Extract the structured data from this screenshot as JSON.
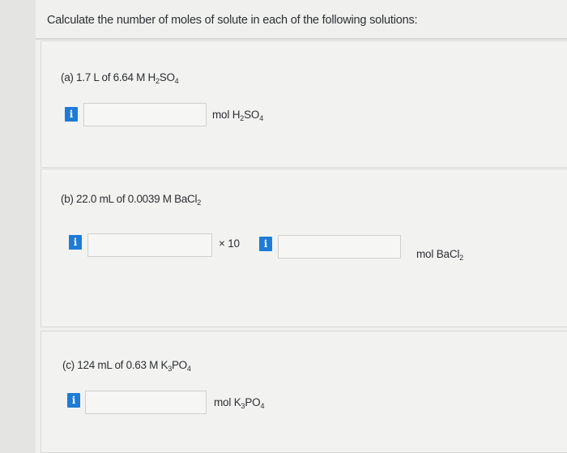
{
  "question": "Calculate the number of moles of solute in each of the following solutions:",
  "parts": {
    "a": {
      "label": {
        "lead": "(a) 1.7 L of 6.64 M H",
        "s1": "2",
        "mid": "SO",
        "s2": "4",
        "tail": ""
      },
      "info": "i",
      "input_value": "",
      "unit": {
        "lead": "mol H",
        "s1": "2",
        "mid": "SO",
        "s2": "4"
      }
    },
    "b": {
      "label": {
        "lead": "(b) 22.0 mL of 0.0039 M BaCl",
        "s1": "2"
      },
      "info_coefficient": "i",
      "coefficient_value": "",
      "times_ten": "× 10",
      "info_exponent": "i",
      "exponent_value": "",
      "unit": {
        "lead": "mol BaCl",
        "s1": "2"
      }
    },
    "c": {
      "label": {
        "lead": "(c) 124  mL of 0.63 M K",
        "s1": "3",
        "mid": "PO",
        "s2": "4"
      },
      "info": "i",
      "input_value": "",
      "unit": {
        "lead": "mol K",
        "s1": "3",
        "mid": "PO",
        "s2": "4"
      }
    }
  },
  "colors": {
    "info_button": "#1e7bd6",
    "background": "#f0f0ee",
    "text": "#2c2f33"
  }
}
